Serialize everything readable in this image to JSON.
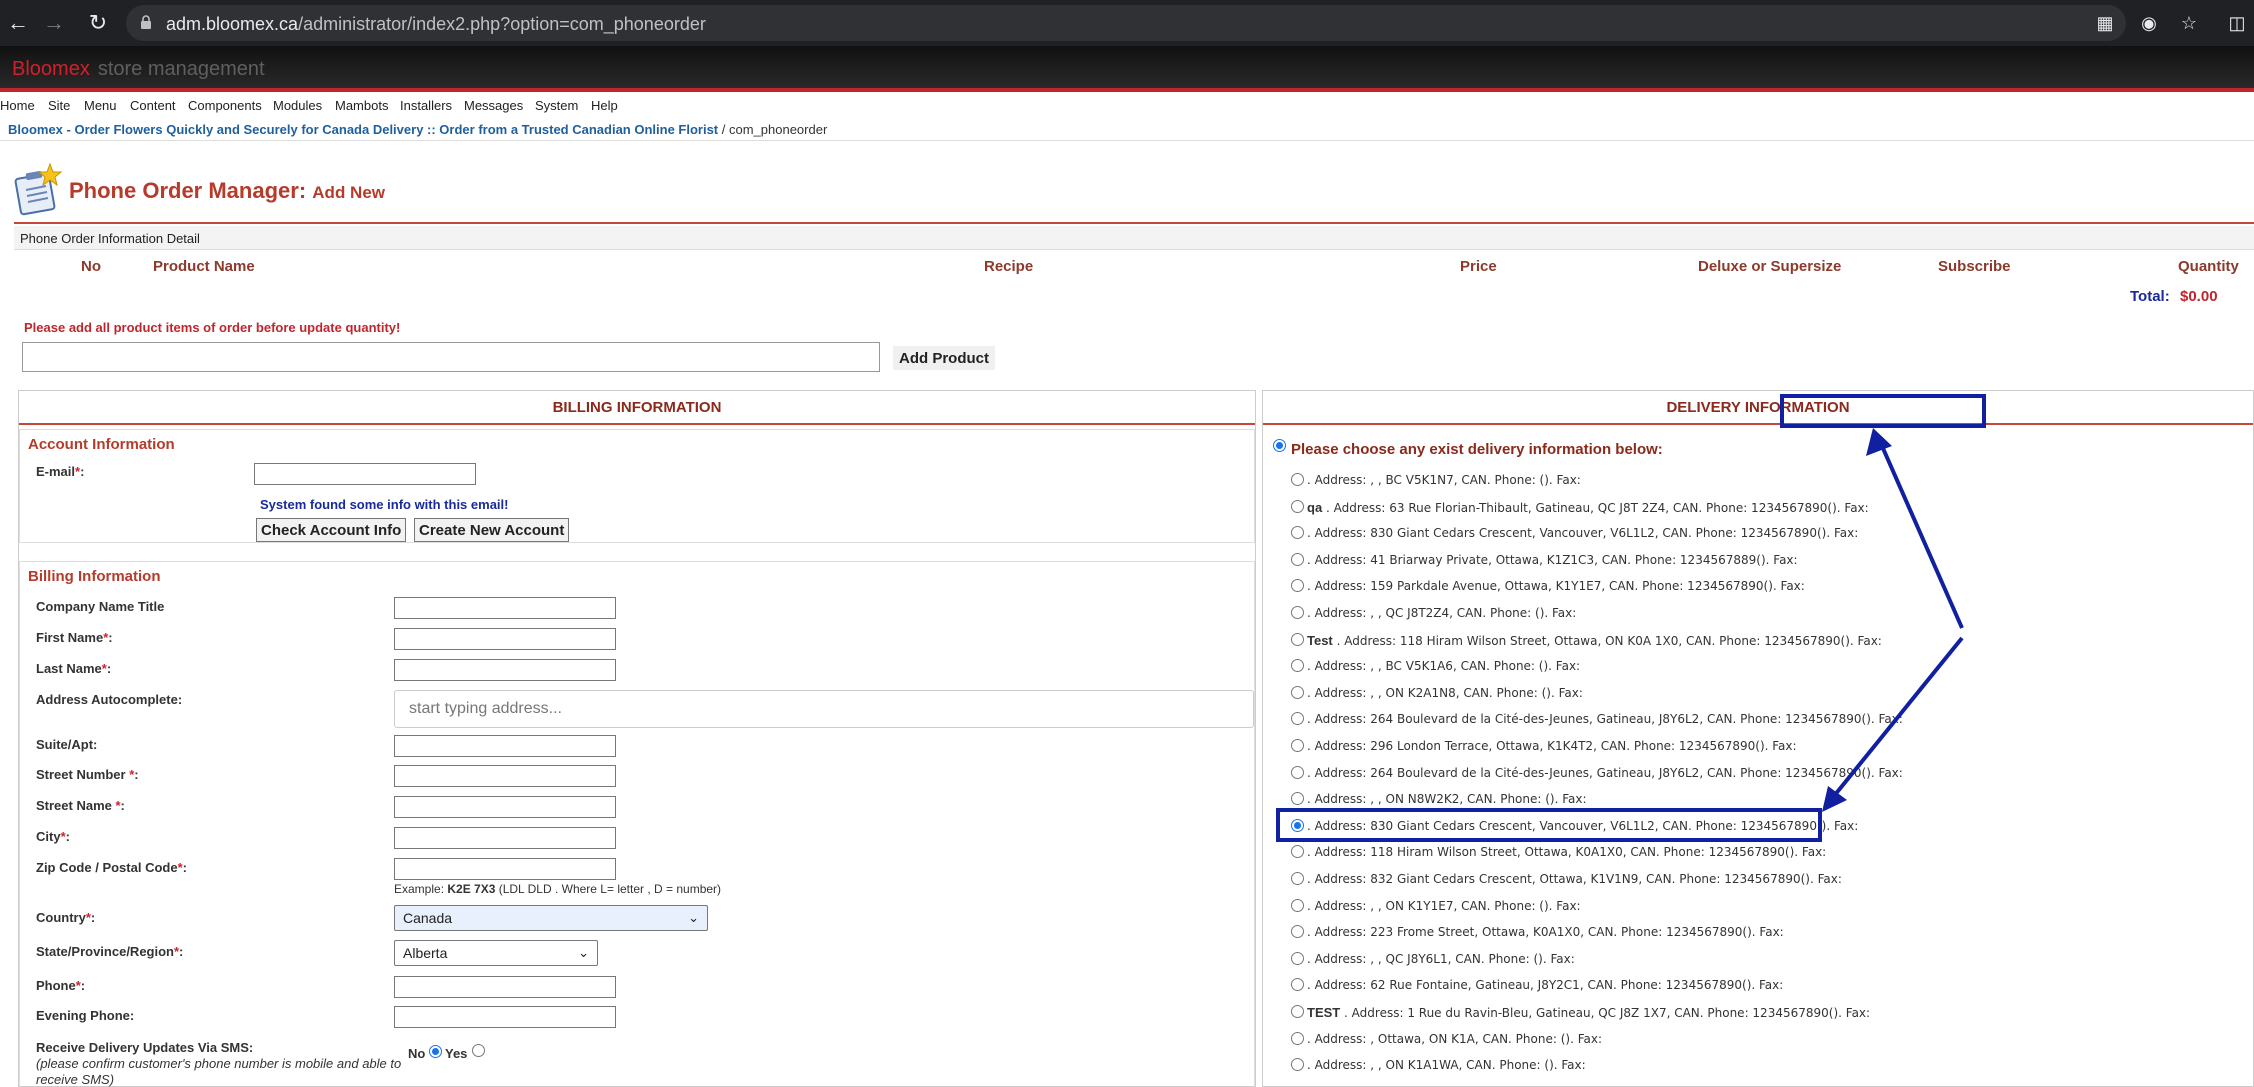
{
  "browser": {
    "url_host": "adm.bloomex.ca",
    "url_path": "/administrator/index2.php?option=com_phoneorder"
  },
  "header": {
    "brand": "Bloomex",
    "subtitle": "store management"
  },
  "menu": [
    "Home",
    "Site",
    "Menu",
    "Content",
    "Components",
    "Modules",
    "Mambots",
    "Installers",
    "Messages",
    "System",
    "Help"
  ],
  "breadcrumb": {
    "link": "Bloomex - Order Flowers Quickly and Securely for Canada Delivery :: Order from a Trusted Canadian Online Florist",
    "current": "/ com_phoneorder"
  },
  "page": {
    "title": "Phone Order Manager:",
    "subtitle": "Add New"
  },
  "product_table": {
    "section_title": "Phone Order Information Detail",
    "columns": [
      "No",
      "Product Name",
      "Recipe",
      "Price",
      "Deluxe or Supersize",
      "Subscribe",
      "Quantity"
    ],
    "total_label": "Total:",
    "total_value": "$0.00",
    "warning": "Please add all product items of order before update quantity!",
    "add_product_label": "Add Product"
  },
  "billing": {
    "header": "BILLING INFORMATION",
    "account": {
      "title": "Account Information",
      "email_label": "E-mail",
      "found_info": "System found some info with this email!",
      "check_button": "Check Account Info",
      "create_button": "Create New Account"
    },
    "info": {
      "title": "Billing Information",
      "company_label": "Company Name Title",
      "first_name_label": "First Name",
      "last_name_label": "Last Name",
      "address_autocomplete_label": "Address Autocomplete:",
      "address_placeholder": "start typing address...",
      "suite_label": "Suite/Apt:",
      "street_number_label": "Street Number ",
      "street_name_label": "Street Name ",
      "city_label": "City",
      "zip_label": "Zip Code / Postal Code",
      "zip_example_prefix": "Example: ",
      "zip_example_code": "K2E 7X3",
      "zip_example_suffix": " (LDL DLD . Where L= letter , D = number)",
      "country_label": "Country",
      "country_value": "Canada",
      "state_label": "State/Province/Region",
      "state_value": "Alberta",
      "phone_label": "Phone",
      "evening_phone_label": "Evening Phone:",
      "sms_label": "Receive Delivery Updates Via SMS:",
      "sms_note": "(please confirm customer's phone number is mobile and able to receive SMS)",
      "sms_no": "No",
      "sms_yes": "Yes"
    }
  },
  "delivery": {
    "header": "DELIVERY INFORMATION",
    "choose_label": "Please choose any exist delivery information below:",
    "addresses": [
      {
        "name": "",
        "text": ". Address: , , BC V5K1N7, CAN. Phone: (). Fax:",
        "selected": false
      },
      {
        "name": "qa",
        "text": " . Address: 63 Rue Florian-Thibault, Gatineau, QC J8T 2Z4, CAN. Phone: 1234567890(). Fax:",
        "selected": false
      },
      {
        "name": "",
        "text": ". Address: 830 Giant Cedars Crescent, Vancouver, V6L1L2, CAN. Phone: 1234567890(). Fax:",
        "selected": false
      },
      {
        "name": "",
        "text": ". Address: 41 Briarway Private, Ottawa, K1Z1C3, CAN. Phone: 1234567889(). Fax:",
        "selected": false
      },
      {
        "name": "",
        "text": ". Address: 159 Parkdale Avenue, Ottawa, K1Y1E7, CAN. Phone: 1234567890(). Fax:",
        "selected": false
      },
      {
        "name": "",
        "text": ". Address: , , QC J8T2Z4, CAN. Phone: (). Fax:",
        "selected": false
      },
      {
        "name": "Test",
        "text": " . Address: 118 Hiram Wilson Street, Ottawa, ON K0A 1X0, CAN. Phone: 1234567890(). Fax:",
        "selected": false
      },
      {
        "name": "",
        "text": ". Address: , , BC V5K1A6, CAN. Phone: (). Fax:",
        "selected": false
      },
      {
        "name": "",
        "text": ". Address: , , ON K2A1N8, CAN. Phone: (). Fax:",
        "selected": false
      },
      {
        "name": "",
        "text": ". Address: 264 Boulevard de la Cité-des-Jeunes, Gatineau, J8Y6L2, CAN. Phone: 1234567890(). Fax:",
        "selected": false
      },
      {
        "name": "",
        "text": ". Address: 296 London Terrace, Ottawa, K1K4T2, CAN. Phone: 1234567890(). Fax:",
        "selected": false
      },
      {
        "name": "",
        "text": ". Address: 264 Boulevard de la Cité-des-Jeunes, Gatineau, J8Y6L2, CAN. Phone: 1234567890(). Fax:",
        "selected": false
      },
      {
        "name": "",
        "text": ". Address: , , ON N8W2K2, CAN. Phone: (). Fax:",
        "selected": false
      },
      {
        "name": "",
        "text": ". Address: 830 Giant Cedars Crescent, Vancouver, V6L1L2, CAN. Phone: 1234567890(). Fax:",
        "selected": true
      },
      {
        "name": "",
        "text": ". Address: 118 Hiram Wilson Street, Ottawa, K0A1X0, CAN. Phone: 1234567890(). Fax:",
        "selected": false
      },
      {
        "name": "",
        "text": ". Address: 832 Giant Cedars Crescent, Ottawa, K1V1N9, CAN. Phone: 1234567890(). Fax:",
        "selected": false
      },
      {
        "name": "",
        "text": ". Address: , , ON K1Y1E7, CAN. Phone: (). Fax:",
        "selected": false
      },
      {
        "name": "",
        "text": ". Address: 223 Frome Street, Ottawa, K0A1X0, CAN. Phone: 1234567890(). Fax:",
        "selected": false
      },
      {
        "name": "",
        "text": ". Address: , , QC J8Y6L1, CAN. Phone: (). Fax:",
        "selected": false
      },
      {
        "name": "",
        "text": ". Address: 62 Rue Fontaine, Gatineau, J8Y2C1, CAN. Phone: 1234567890(). Fax:",
        "selected": false
      },
      {
        "name": "TEST",
        "text": " . Address: 1 Rue du Ravin-Bleu, Gatineau, QC J8Z 1X7, CAN. Phone: 1234567890(). Fax:",
        "selected": false
      },
      {
        "name": "",
        "text": ". Address: , Ottawa, ON K1A, CAN. Phone: (). Fax:",
        "selected": false
      },
      {
        "name": "",
        "text": ". Address: , , ON K1A1WA, CAN. Phone: (). Fax:",
        "selected": false
      }
    ]
  },
  "colors": {
    "accent_red": "#c0262d",
    "heading_brown": "#8b2a1c",
    "annotation_blue": "#1020a0"
  }
}
